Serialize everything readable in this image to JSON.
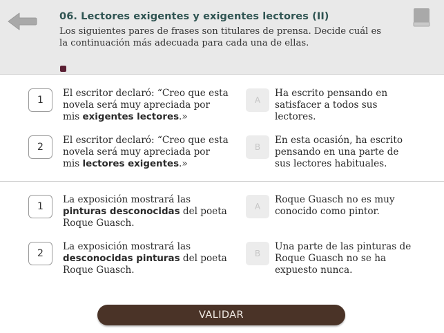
{
  "header": {
    "title": "06. Lectores exigentes y exigentes lectores (II)",
    "instructions": "Los siguientes pares de frases son titulares de prensa. Decide cuál es la continuación más adecuada para cada una de ellas."
  },
  "groups": [
    {
      "items": [
        {
          "number": "1",
          "pre": "El escritor declaró: “Creo que esta novela será muy apreciada por mis ",
          "bold": "exigentes lectores",
          "post": ".»"
        },
        {
          "number": "2",
          "pre": "El escritor declaró: “Creo que esta novela será muy apreciada por mis ",
          "bold": "lectores exigentes",
          "post": ".»"
        }
      ],
      "options": [
        {
          "letter": "A",
          "text": "Ha escrito pensando en satisfacer a todos sus lectores."
        },
        {
          "letter": "B",
          "text": "En esta ocasión, ha escrito pensando en una parte de sus lectores habituales."
        }
      ]
    },
    {
      "items": [
        {
          "number": "1",
          "pre": "La exposición mostrará las ",
          "bold": "pinturas desconocidas",
          "post": " del poeta Roque Guasch."
        },
        {
          "number": "2",
          "pre": "La exposición mostrará las ",
          "bold": "desconocidas pinturas",
          "post": " del poeta Roque Guasch."
        }
      ],
      "options": [
        {
          "letter": "A",
          "text": "Roque Guasch no es muy conocido como pintor."
        },
        {
          "letter": "B",
          "text": "Una parte de las pinturas de Roque Guasch no se ha expuesto nunca."
        }
      ]
    }
  ],
  "validate_label": "VALIDAR",
  "icons": {
    "back": "back-arrow-icon",
    "book": "book-icon"
  },
  "colors": {
    "title": "#2f5452",
    "button": "#4a3327",
    "page_dot": "#5a1f33",
    "header_bg": "#e9e9e9"
  }
}
